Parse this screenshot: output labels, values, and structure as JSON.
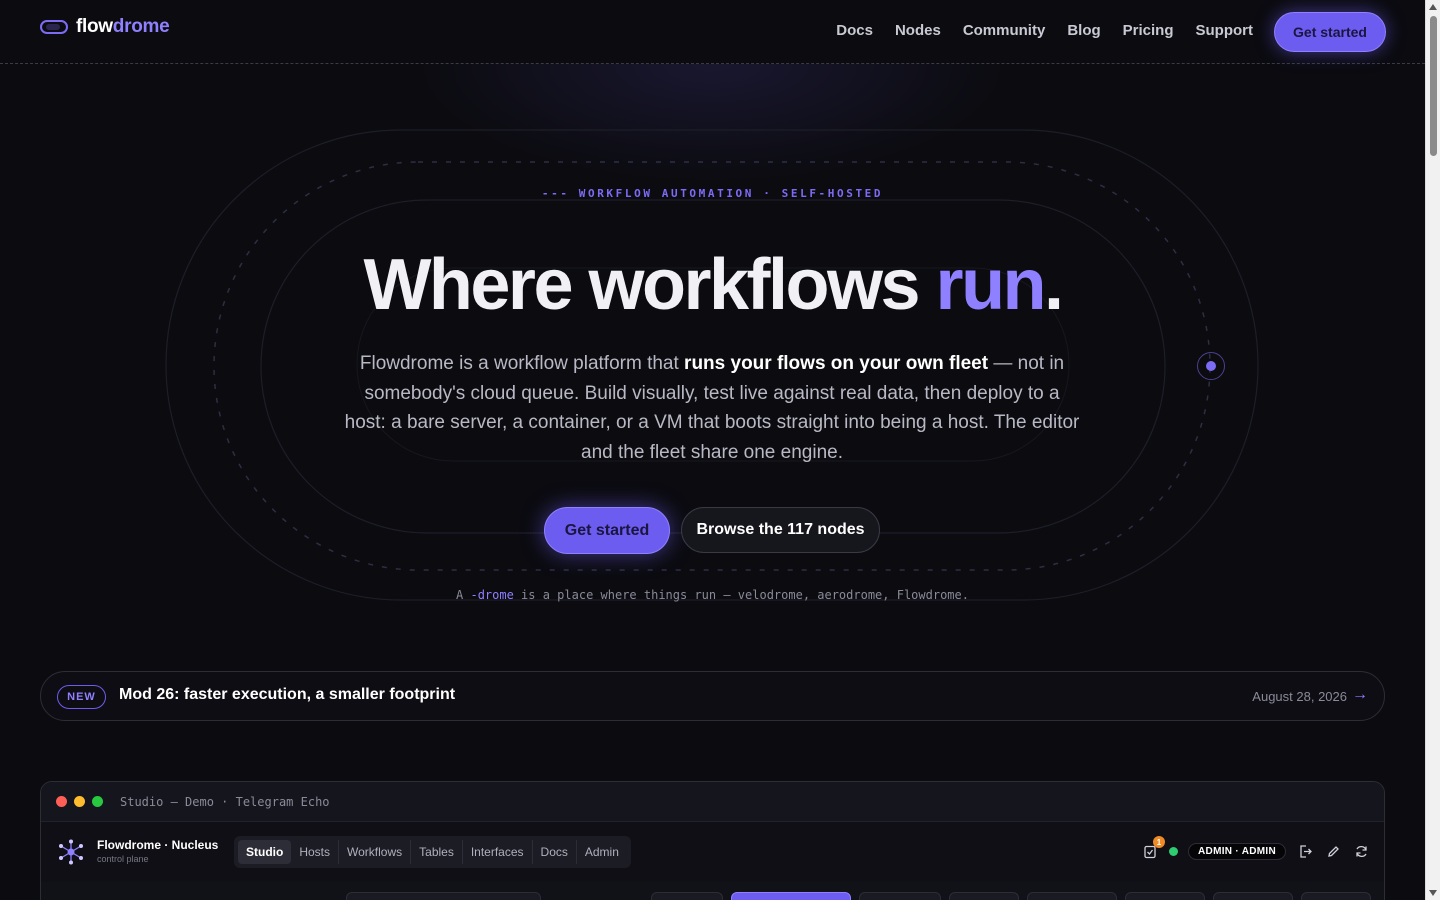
{
  "nav": {
    "logo_part1": "flow",
    "logo_part2": "drome",
    "links": [
      "Docs",
      "Nodes",
      "Community",
      "Blog",
      "Pricing",
      "Support"
    ],
    "cta": "Get started"
  },
  "hero": {
    "eyebrow": "--- WORKFLOW AUTOMATION · SELF-HOSTED",
    "headline_main": "Where workflows ",
    "headline_accent": "run",
    "headline_end": ".",
    "lede_pre": "Flowdrome is a workflow platform that ",
    "lede_strong": "runs your flows on your own fleet",
    "lede_post": " — not in somebody's cloud queue. Build visually, test live against real data, then deploy to a host: a bare server, a container, or a VM that boots straight into being a host. The editor and the fleet share one engine.",
    "primary_button": "Get started",
    "secondary_button": "Browse the 117 nodes",
    "tagline_pre": "A ",
    "tagline_hl": "-drome",
    "tagline_post": " is a place where things run — velodrome, aerodrome, Flowdrome."
  },
  "news": {
    "badge": "NEW",
    "title": "Mod 26: faster execution, a smaller footprint",
    "date": "August 28, 2026",
    "arrow": "→"
  },
  "studio": {
    "window_title": "Studio — Demo · Telegram Echo",
    "brand_name": "Flowdrome · Nucleus",
    "brand_sub": "control plane",
    "tabs": [
      "Studio",
      "Hosts",
      "Workflows",
      "Tables",
      "Interfaces",
      "Docs",
      "Admin"
    ],
    "active_tab": "Studio",
    "notification_count": "1",
    "user_pill": "ADMIN · ADMIN"
  },
  "colors": {
    "accent": "#6d5cf0",
    "accent_light": "#8e80ff",
    "background": "#0b0b10",
    "status_online": "#2ecc71",
    "notification": "#f08a24"
  }
}
